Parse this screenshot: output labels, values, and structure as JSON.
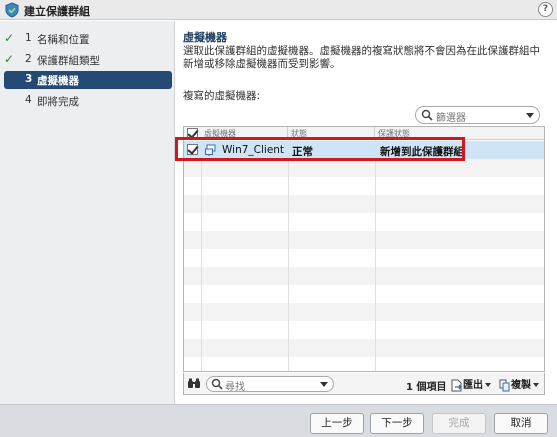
{
  "window": {
    "title": "建立保護群組",
    "help_label": "?"
  },
  "steps": [
    {
      "num": "1",
      "label": "名稱和位置",
      "done": true
    },
    {
      "num": "2",
      "label": "保護群組類型",
      "done": true
    },
    {
      "num": "3",
      "label": "虛擬機器",
      "done": false,
      "active": true
    },
    {
      "num": "4",
      "label": "即將完成",
      "done": false
    }
  ],
  "section": {
    "title": "虛擬機器",
    "description": "選取此保護群組的虛擬機器。虛擬機器的複寫狀態將不會因為在此保護群組中新增或移除虛擬機器而受到影響。",
    "list_label": "複寫的虛擬機器:"
  },
  "filter": {
    "placeholder": "篩選器"
  },
  "table": {
    "headers": [
      "虛擬機器",
      "狀態",
      "保護狀態"
    ],
    "rows": [
      {
        "checked": true,
        "vm": "Win7_Client",
        "status": "正常",
        "protection": "新增到此保護群組"
      }
    ]
  },
  "grid_footer": {
    "find_placeholder": "尋找",
    "count": "1 個項目",
    "export_label": "匯出",
    "copy_label": "複製"
  },
  "buttons": {
    "back": "上一步",
    "next": "下一步",
    "finish": "完成",
    "cancel": "取消"
  },
  "colors": {
    "accent": "#244a73",
    "highlight": "#d0181f",
    "row_selected": "#cfe4f6"
  }
}
